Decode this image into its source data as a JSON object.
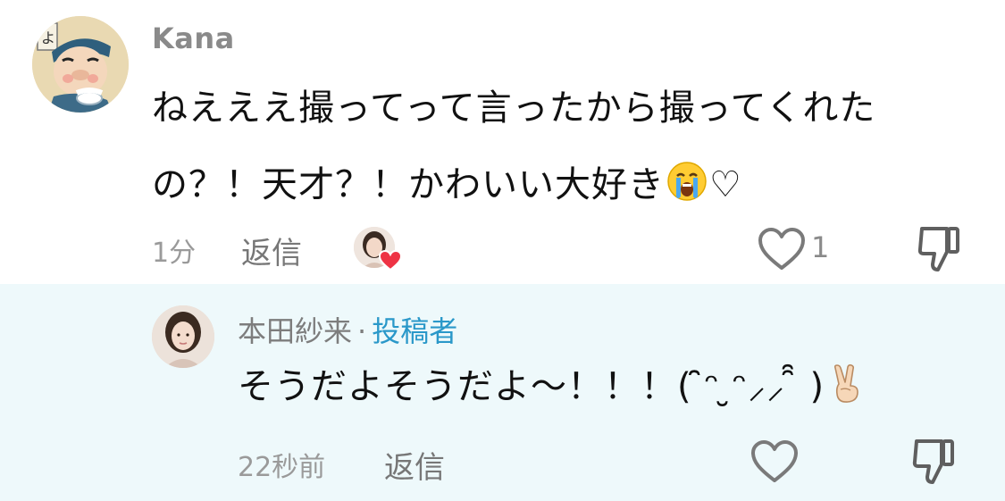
{
  "comment": {
    "username": "Kana",
    "text_line1": "ねえええ撮ってって言ったから撮ってくれた",
    "text_line2": "の？！天才？！かわいい大好き",
    "text_tail": "♡",
    "emoji": "loudly-crying-face-emoji",
    "time": "1分",
    "reply_label": "返信",
    "liked_by_creator": true,
    "like_count": "1",
    "icons": {
      "like": "heart-outline-icon",
      "dislike": "thumbs-down-icon",
      "creator_heart": "red-heart-icon"
    }
  },
  "reply": {
    "username": "本田紗来",
    "separator": "·",
    "creator_label": "投稿者",
    "text": "そうだよそうだよ〜！！！( ̑̑ᵔ ̮ᵔ⸝⸝ ̑̑ )",
    "emoji": "victory-hand-emoji",
    "time": "22秒前",
    "reply_label": "返信",
    "icons": {
      "like": "heart-outline-icon",
      "dislike": "thumbs-down-icon"
    }
  },
  "colors": {
    "reply_background": "#eef9fb",
    "creator_label": "#2a98c9",
    "like_heart": "#ee3344",
    "meta_text": "#9a9a9a"
  }
}
